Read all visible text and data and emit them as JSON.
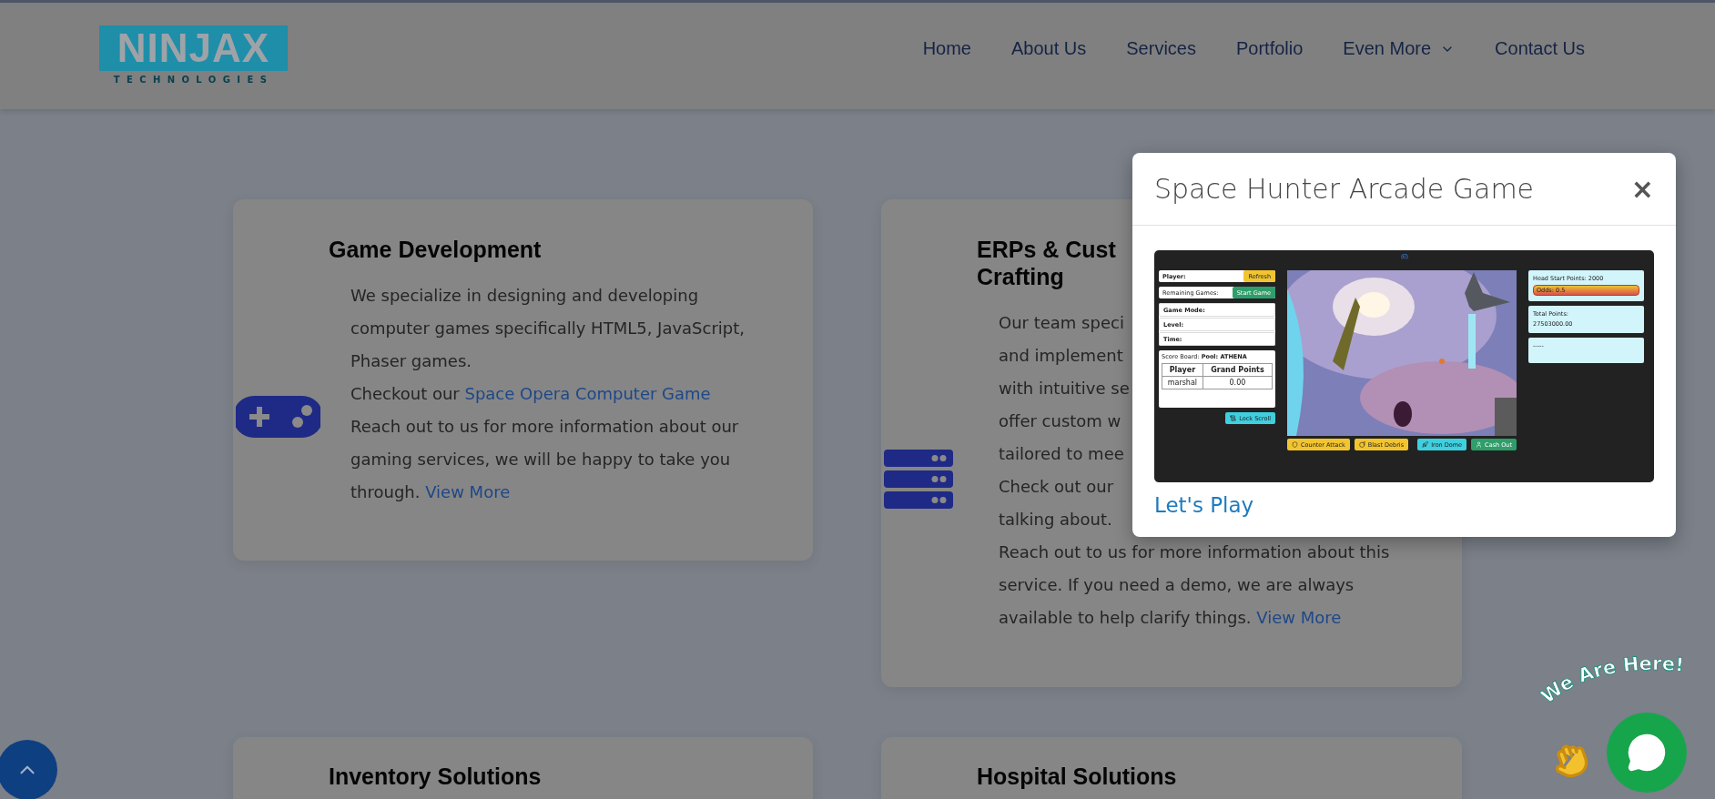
{
  "header": {
    "logo": {
      "name": "NINJAX",
      "tagline": "TECHNOLOGIES"
    },
    "nav": [
      {
        "label": "Home",
        "dropdown": false
      },
      {
        "label": "About Us",
        "dropdown": false
      },
      {
        "label": "Services",
        "dropdown": false
      },
      {
        "label": "Portfolio",
        "dropdown": false
      },
      {
        "label": "Even More",
        "dropdown": true
      },
      {
        "label": "Contact Us",
        "dropdown": false
      }
    ]
  },
  "services": [
    {
      "title_lines": [
        "Game Development"
      ],
      "paragraphs": [
        {
          "segments": [
            {
              "text": "We specialize in designing and developing computer games specifically HTML5, JavaScript, Phaser games."
            }
          ]
        },
        {
          "segments": [
            {
              "text": "Checkout our "
            },
            {
              "link": "Space Opera Computer Game"
            }
          ]
        },
        {
          "segments": [
            {
              "text": "Reach out to us for more information about our gaming services, we will be happy to take you through. "
            },
            {
              "link": "View More"
            }
          ]
        }
      ]
    },
    {
      "title_lines": [
        "ERPs & Cust",
        "Crafting"
      ],
      "paragraphs": [
        {
          "segments": [
            {
              "text": "Our team speci"
            }
          ]
        },
        {
          "segments": [
            {
              "text": "and implement"
            }
          ]
        },
        {
          "segments": [
            {
              "text": "with intuitive se"
            }
          ]
        },
        {
          "segments": [
            {
              "text": "offer custom w"
            }
          ]
        },
        {
          "segments": [
            {
              "text": "tailored to mee"
            }
          ]
        },
        {
          "segments": [
            {
              "text": "Check out our"
            }
          ]
        },
        {
          "segments": [
            {
              "text": "talking about."
            }
          ]
        },
        {
          "segments": [
            {
              "text": "Reach out to us for more information about this service. If you need a demo, we are always available to help clarify things. "
            },
            {
              "link": "View More"
            }
          ]
        }
      ]
    },
    {
      "title_lines": [
        "Inventory Solutions"
      ]
    },
    {
      "title_lines": [
        "Hospital Solutions"
      ]
    }
  ],
  "modal": {
    "title": "Space Hunter Arcade Game",
    "close": "×",
    "link": "Let's Play",
    "game": {
      "player_label": "Player:",
      "refresh": "Refresh",
      "remaining_label": "Remaining Games:",
      "start": "Start Game",
      "stats": [
        "Game Mode:",
        "Level:",
        "Time:"
      ],
      "scoreboard": {
        "label": "Score Board:",
        "pool": "Pool: ATHENA",
        "columns": [
          "Player",
          "Grand Points"
        ],
        "rows": [
          [
            "marshal",
            "0.00"
          ]
        ]
      },
      "lock": "Lock Scroll",
      "actions": [
        {
          "label": "Counter Attack",
          "color": "#f2c530"
        },
        {
          "label": "Blast Debris",
          "color": "#f2c530"
        },
        {
          "label": "Iron Dome",
          "color": "#3fd0e0"
        },
        {
          "label": "Cash Out",
          "color": "#2e9e6a"
        }
      ],
      "head_start": "Head Start Points: 2000",
      "odds": "Odds: 0.5",
      "total_label": "Total Points:",
      "total": "27503000.00",
      "note": "-----"
    }
  },
  "chat": {
    "tagline": "We Are Here!"
  }
}
